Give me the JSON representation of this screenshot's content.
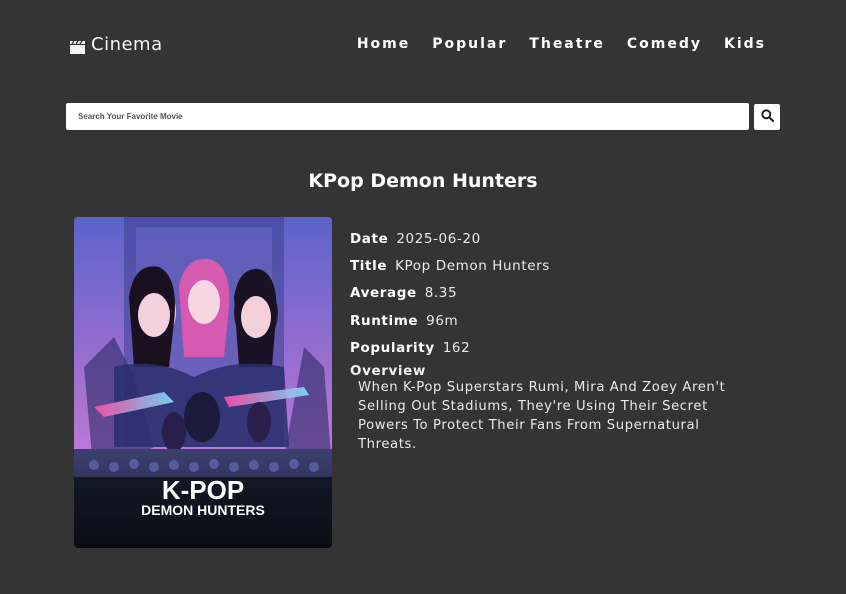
{
  "header": {
    "brand": "Cinema",
    "nav": [
      "Home",
      "Popular",
      "Theatre",
      "Comedy",
      "Kids"
    ]
  },
  "search": {
    "placeholder": "Search Your Favorite Movie",
    "value": ""
  },
  "movie": {
    "heading": "KPop Demon Hunters",
    "poster_title_line1": "K-POP",
    "poster_title_line2": "DEMON HUNTERS",
    "details": [
      {
        "label": "Date",
        "value": "2025-06-20"
      },
      {
        "label": "Title",
        "value": "KPop Demon Hunters"
      },
      {
        "label": "Average",
        "value": "8.35"
      },
      {
        "label": "Runtime",
        "value": "96m"
      },
      {
        "label": "Popularity",
        "value": "162"
      }
    ],
    "overview_label": "Overview",
    "overview": "When K-Pop Superstars Rumi, Mira And Zoey Aren't Selling Out Stadiums, They're Using Their Secret Powers To Protect Their Fans From Supernatural Threats."
  },
  "colors": {
    "background": "#343434",
    "text": "#ffffff"
  },
  "icons": {
    "brand": "clapperboard-icon",
    "search": "search-icon"
  }
}
